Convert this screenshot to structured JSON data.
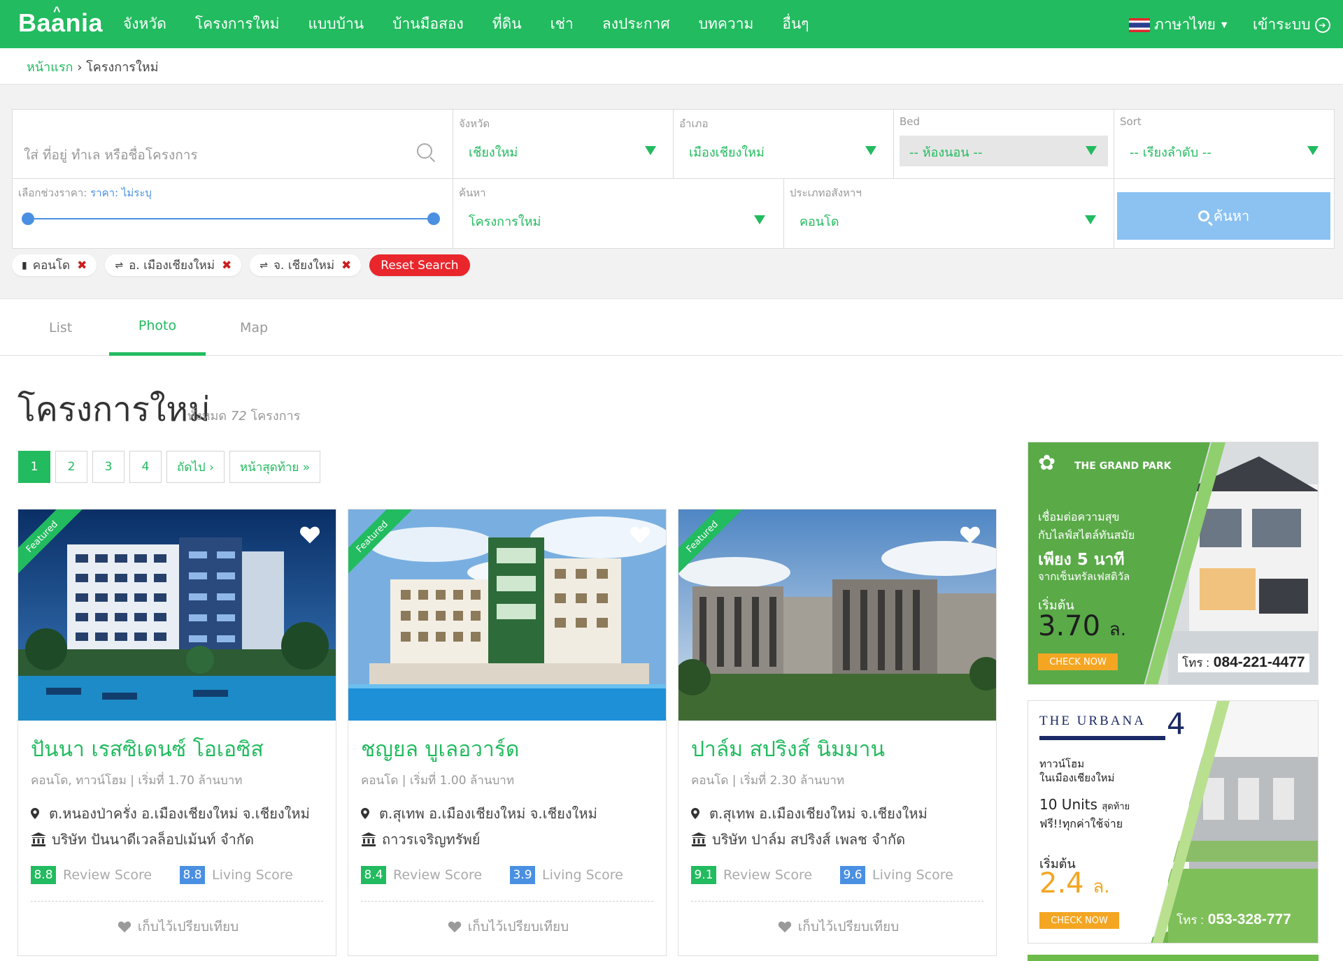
{
  "nav": {
    "logo": "Baania",
    "menu": [
      "จังหวัด",
      "โครงการใหม่",
      "แบบบ้าน",
      "บ้านมือสอง",
      "ที่ดิน",
      "เช่า",
      "ลงประกาศ",
      "บทความ",
      "อื่นๆ"
    ],
    "language": "ภาษาไทย",
    "login": "เข้าระบบ"
  },
  "breadcrumb": {
    "home": "หน้าแรก",
    "separator": "›",
    "current": "โครงการใหม่"
  },
  "search": {
    "keyword_placeholder": "ใส่ ที่อยู่ ทำเล หรือชื่อโครงการ",
    "province": {
      "label": "จังหวัด",
      "value": "เชียงใหม่"
    },
    "district": {
      "label": "อำเภอ",
      "value": "เมืองเชียงใหม่"
    },
    "bed": {
      "label": "Bed",
      "value": "-- ห้องนอน --"
    },
    "sort": {
      "label": "Sort",
      "value": "-- เรียงลำดับ --"
    },
    "price": {
      "label": "เลือกช่วงราคา:",
      "value": "ราคา: ไม่ระบุ",
      "min_fraction": 0,
      "max_fraction": 1
    },
    "find": {
      "label": "ค้นหา",
      "value": "โครงการใหม่"
    },
    "property_type": {
      "label": "ประเภทอสังหาฯ",
      "value": "คอนโด"
    },
    "button": "ค้นหา"
  },
  "filters": [
    {
      "icon": "building-icon",
      "label": "คอนโด"
    },
    {
      "icon": "map-sign-icon",
      "label": "อ. เมืองเชียงใหม่"
    },
    {
      "icon": "map-sign-icon",
      "label": "จ. เชียงใหม่"
    }
  ],
  "reset_label": "Reset Search",
  "tabs": [
    "List",
    "Photo",
    "Map"
  ],
  "active_tab": "Photo",
  "heading": {
    "title": "โครงการใหม่",
    "total_prefix": "ทั้งหมด",
    "total_count": "72",
    "total_suffix": "โครงการ"
  },
  "pagination": {
    "pages": [
      "1",
      "2",
      "3",
      "4"
    ],
    "active": "1",
    "next": "ถัดไป ›",
    "last": "หน้าสุดท้าย »"
  },
  "listings": [
    {
      "badge": "Featured",
      "name": "ปันนา เรสซิเดนซ์ โอเอซิส",
      "meta": "คอนโด, ทาวน์โฮม | เริ่มที่ 1.70 ล้านบาท",
      "location": "ต.หนองป่าครั่ง อ.เมืองเชียงใหม่ จ.เชียงใหม่",
      "developer": "บริษัท ปันนาดีเวลล็อปเม้นท์ จำกัด",
      "review_score": "8.8",
      "living_score": "8.8"
    },
    {
      "badge": "Featured",
      "name": "ชญยล บูเลอวาร์ด",
      "meta": "คอนโด | เริ่มที่ 1.00 ล้านบาท",
      "location": "ต.สุเทพ อ.เมืองเชียงใหม่ จ.เชียงใหม่",
      "developer": "ถาวรเจริญทรัพย์",
      "review_score": "8.4",
      "living_score": "3.9"
    },
    {
      "badge": "Featured",
      "name": "ปาล์ม สปริงส์ นิมมาน",
      "meta": "คอนโด | เริ่มที่ 2.30 ล้านบาท",
      "location": "ต.สุเทพ อ.เมืองเชียงใหม่ จ.เชียงใหม่",
      "developer": "บริษัท ปาล์ม สปริงส์ เพลช จำกัด",
      "review_score": "9.1",
      "living_score": "9.6"
    }
  ],
  "score_labels": {
    "review": "Review Score",
    "living": "Living Score"
  },
  "compare_label": "เก็บไว้เปรียบเทียบ",
  "ads": [
    {
      "brand": "THE GRAND PARK",
      "line1": "เชื่อมต่อความสุข",
      "line2": "กับไลฟ์สไตล์ทันสมัย",
      "line3": "เพียง 5 นาที",
      "line4": "จากเซ็นทรัลเฟสติวัล",
      "start_label": "เริ่มต้น",
      "price": "3.70",
      "price_unit": "ล.",
      "cta": "CHECK NOW",
      "phone_label": "โทร :",
      "phone": "084-221-4477"
    },
    {
      "brand": "THE URBANA",
      "brand_num": "4",
      "line1": "ทาวน์โฮม",
      "line2": "ในเมืองเชียงใหม่",
      "units": "10 Units",
      "units_suffix": "สุดท้าย",
      "free": "ฟรี!!ทุกค่าใช้จ่าย",
      "start_label": "เริ่มต้น",
      "price": "2.4",
      "price_unit": "ล.",
      "cta": "CHECK NOW",
      "phone_label": "โทร :",
      "phone": "053-328-777"
    }
  ],
  "colors": {
    "brand": "#22bb5f",
    "accent_blue": "#4a90e2",
    "danger": "#e8262c"
  }
}
